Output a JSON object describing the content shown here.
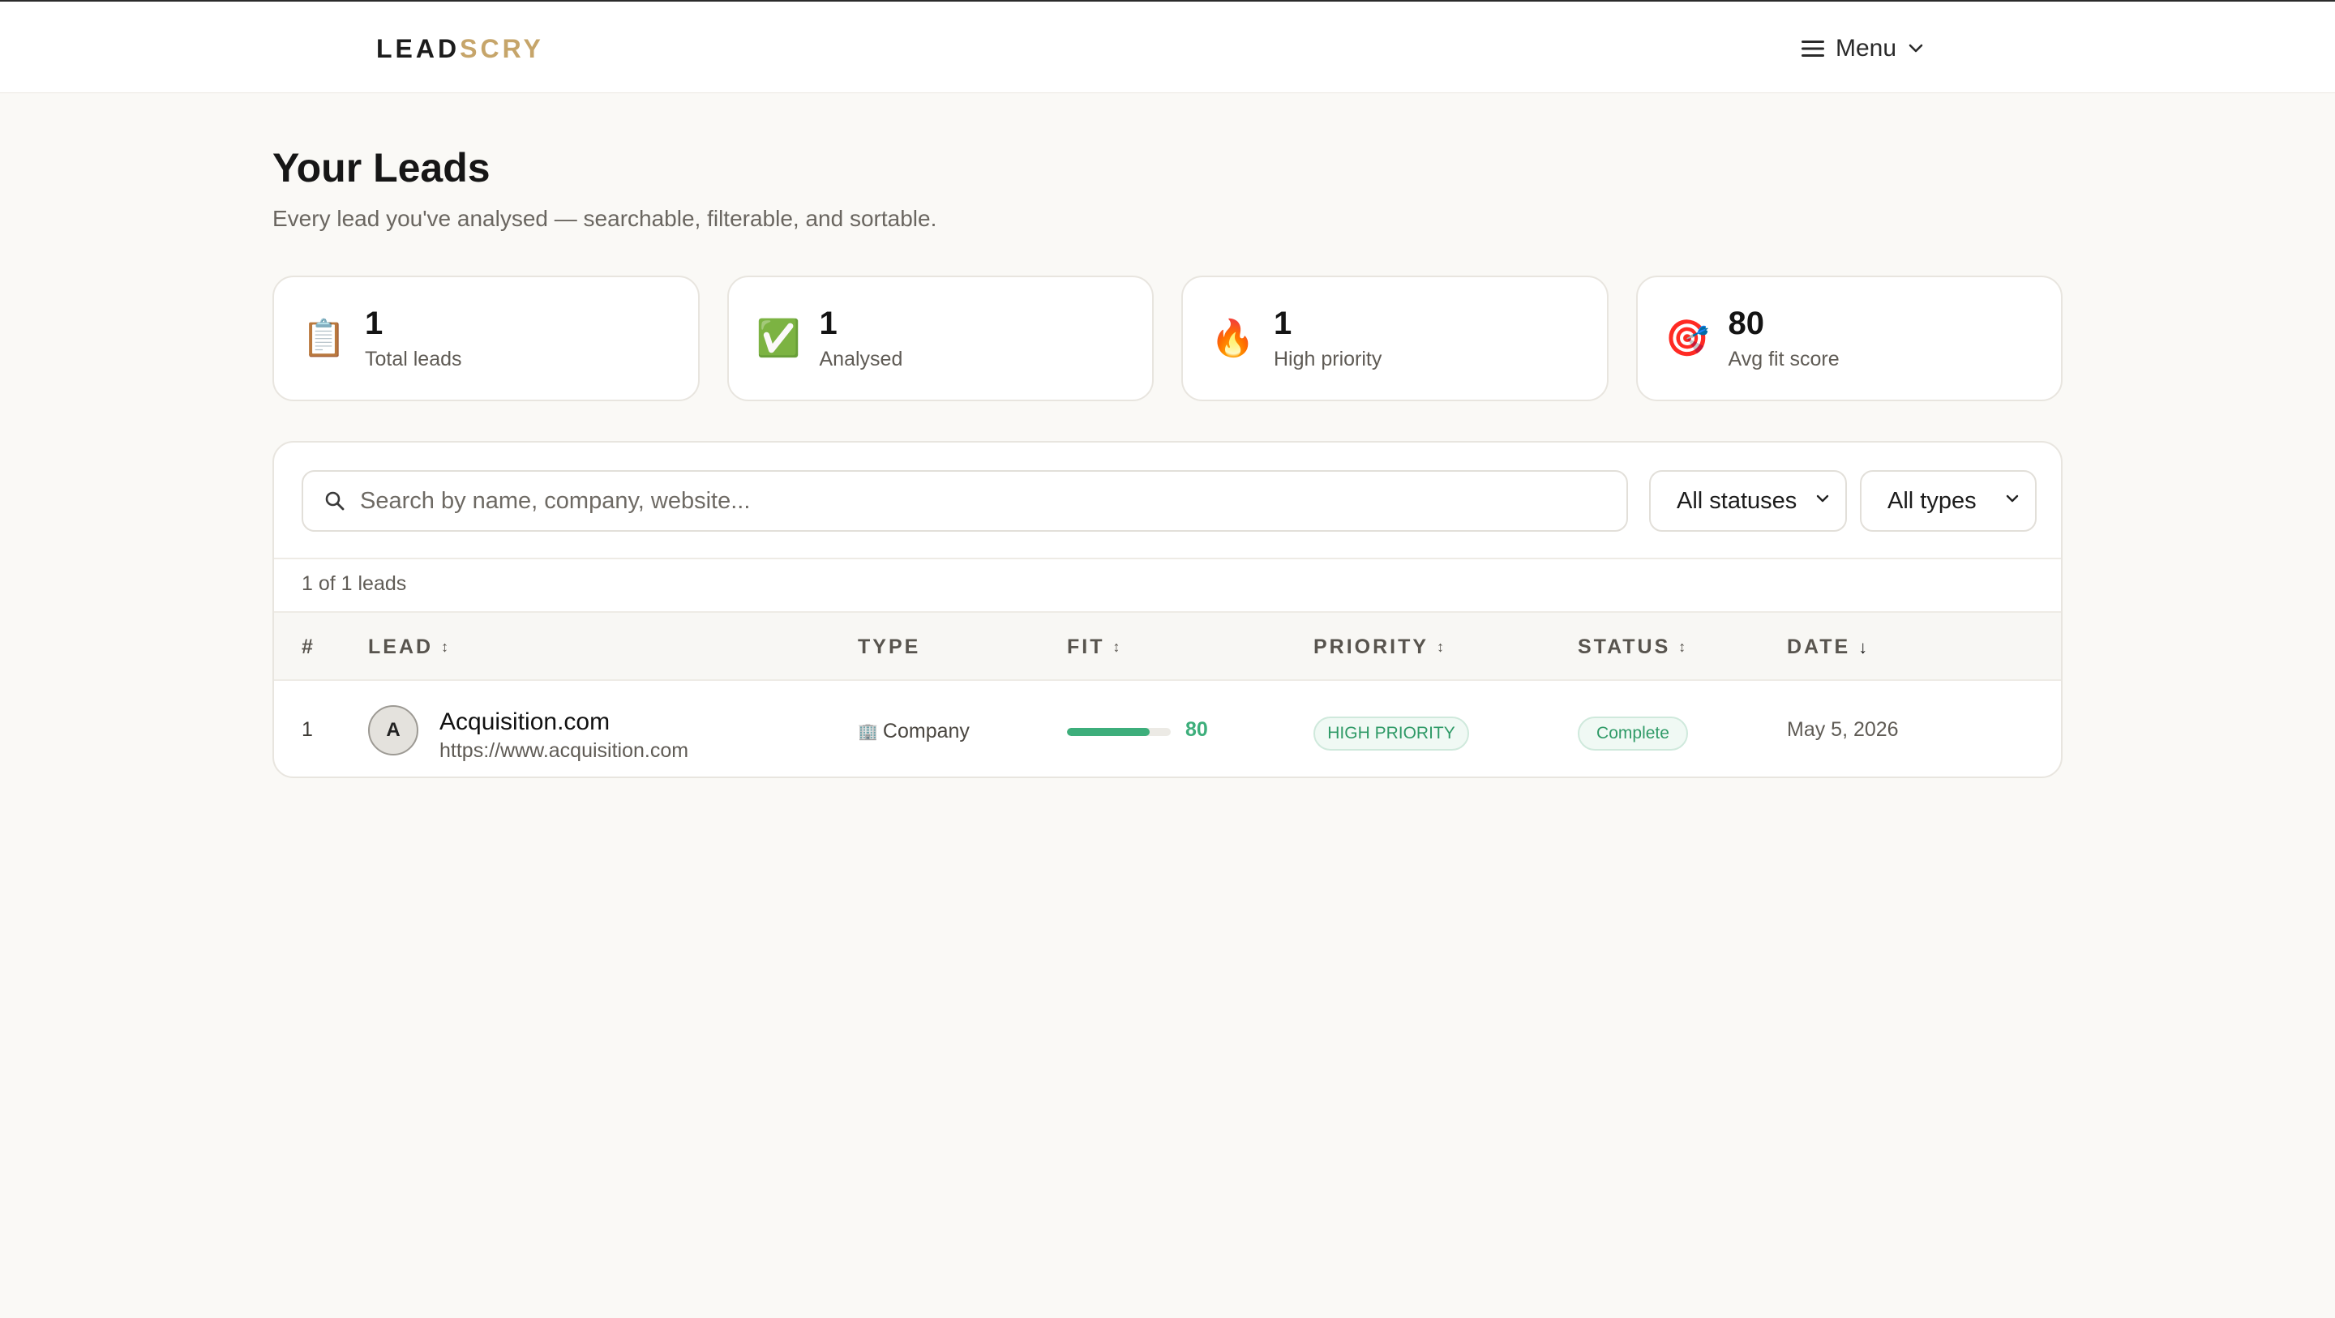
{
  "header": {
    "logo_main": "LEAD",
    "logo_accent": "SCRY",
    "menu_label": "Menu"
  },
  "page": {
    "title": "Your Leads",
    "subtitle": "Every lead you've analysed — searchable, filterable, and sortable."
  },
  "stats": [
    {
      "icon": "clipboard-icon",
      "glyph": "📋",
      "value": "1",
      "label": "Total leads"
    },
    {
      "icon": "check-mark-icon",
      "glyph": "✅",
      "value": "1",
      "label": "Analysed"
    },
    {
      "icon": "fire-icon",
      "glyph": "🔥",
      "value": "1",
      "label": "High priority"
    },
    {
      "icon": "target-icon",
      "glyph": "🎯",
      "value": "80",
      "label": "Avg fit score"
    }
  ],
  "filters": {
    "search_placeholder": "Search by name, company, website...",
    "status_selected": "All statuses",
    "type_selected": "All types",
    "count_text": "1 of 1 leads"
  },
  "table": {
    "columns": [
      {
        "label": "#",
        "sort": ""
      },
      {
        "label": "LEAD",
        "sort": "↕"
      },
      {
        "label": "TYPE",
        "sort": ""
      },
      {
        "label": "FIT",
        "sort": "↕"
      },
      {
        "label": "PRIORITY",
        "sort": "↕"
      },
      {
        "label": "STATUS",
        "sort": "↕"
      },
      {
        "label": "DATE",
        "sort": "↓"
      }
    ],
    "rows": [
      {
        "index": "1",
        "avatar_letter": "A",
        "name": "Acquisition.com",
        "url": "https://www.acquisition.com",
        "type_icon": "building-icon",
        "type_glyph": "🏢",
        "type": "Company",
        "fit_score": "80",
        "fit_fraction": 0.8,
        "priority": "HIGH PRIORITY",
        "status": "Complete",
        "date": "May 5, 2026"
      }
    ]
  },
  "colors": {
    "accent": "#c6a56a",
    "success": "#3dae7b",
    "background": "#faf9f6"
  }
}
